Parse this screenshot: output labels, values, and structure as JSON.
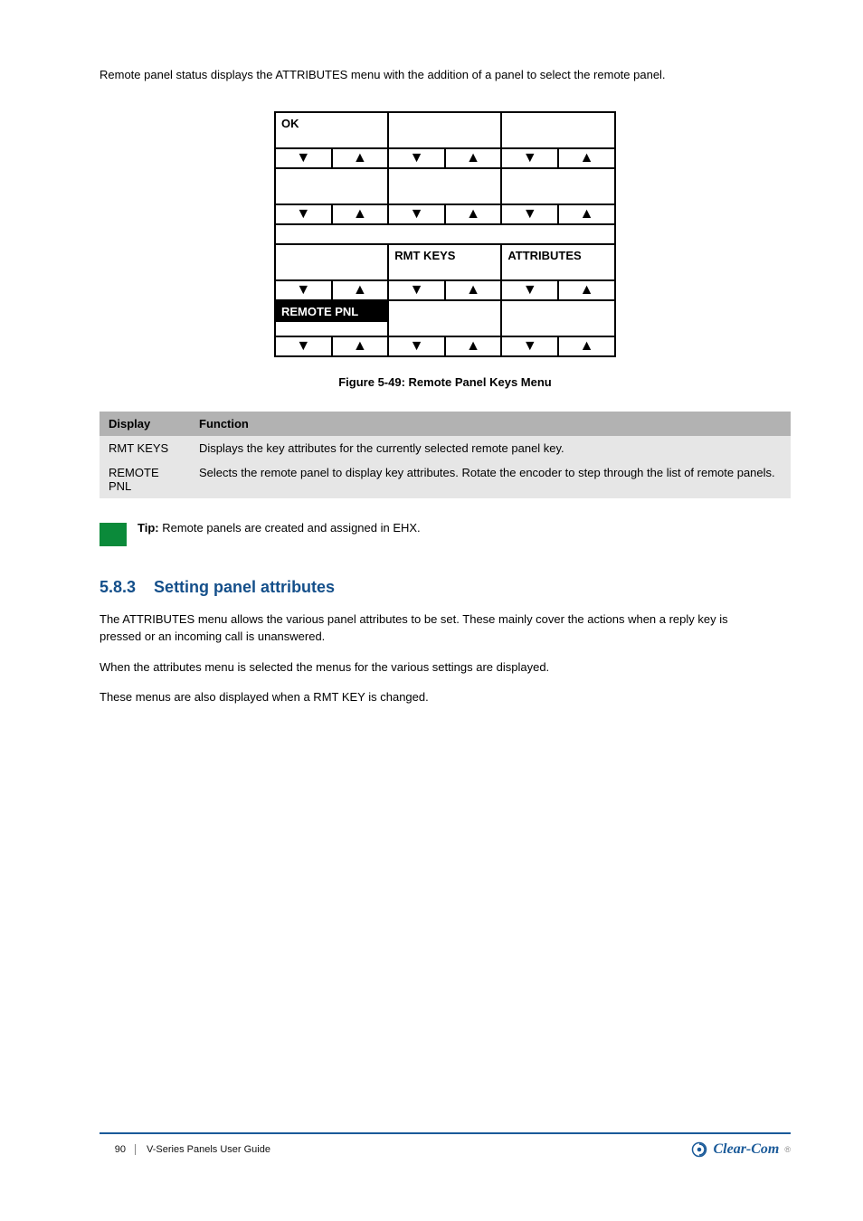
{
  "intro": "Remote panel status displays the ATTRIBUTES menu with the addition of a panel to select the remote panel.",
  "diagram": {
    "cells": {
      "r1c1": "OK",
      "r3c2": "RMT KEYS",
      "r3c3": "ATTRIBUTES",
      "r4c1": "REMOTE PNL"
    },
    "arrows": {
      "down": "▼",
      "up": "▲"
    }
  },
  "figure_caption": "Figure 5-49: Remote Panel Keys Menu",
  "table": {
    "headers": [
      "Display",
      "Function"
    ],
    "rows": [
      [
        "RMT KEYS",
        "Displays the key attributes for the currently selected remote panel key."
      ],
      [
        "REMOTE PNL",
        "Selects the remote panel to display key attributes. Rotate the encoder to step through the list of remote panels."
      ]
    ]
  },
  "tip": {
    "label": "Tip:",
    "text": "Remote panels are created and assigned in EHX."
  },
  "section": {
    "number": "5.8.3",
    "title": "Setting panel attributes"
  },
  "body": [
    "The ATTRIBUTES menu allows the various panel attributes to be set. These mainly cover the actions when a reply key is pressed or an incoming call is unanswered.",
    "When the attributes menu is selected the menus for the various settings are displayed.",
    "These menus are also displayed when a RMT KEY is changed."
  ],
  "footer": {
    "page": "90",
    "doc_title": "V-Series Panels User Guide",
    "brand": "Clear-Com"
  }
}
